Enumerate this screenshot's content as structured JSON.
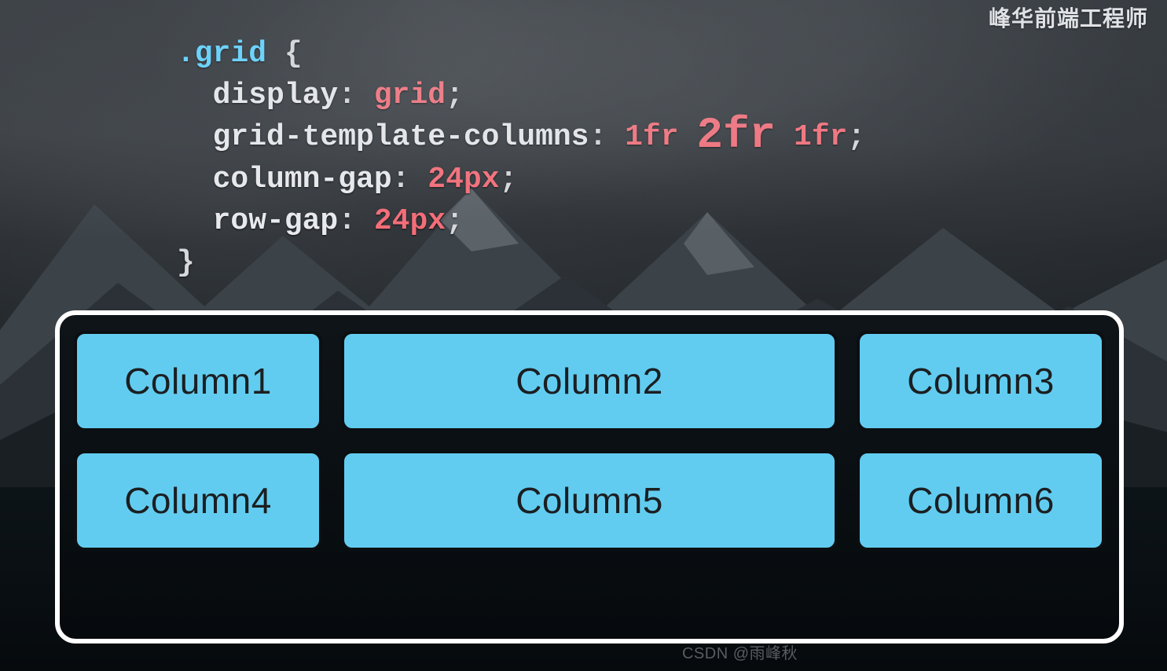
{
  "watermark_top": "峰华前端工程师",
  "watermark_bottom": "CSDN @雨峰秋",
  "code": {
    "selector": ".grid",
    "lines": [
      {
        "prop": "display",
        "value": "grid"
      },
      {
        "prop": "grid-template-columns",
        "value_parts": [
          "1fr ",
          "2fr",
          " 1fr"
        ],
        "emph_index": 1
      },
      {
        "prop": "column-gap",
        "value": "24px"
      },
      {
        "prop": "row-gap",
        "value": "24px"
      }
    ]
  },
  "grid": {
    "items": [
      "Column1",
      "Column2",
      "Column3",
      "Column4",
      "Column5",
      "Column6"
    ]
  }
}
